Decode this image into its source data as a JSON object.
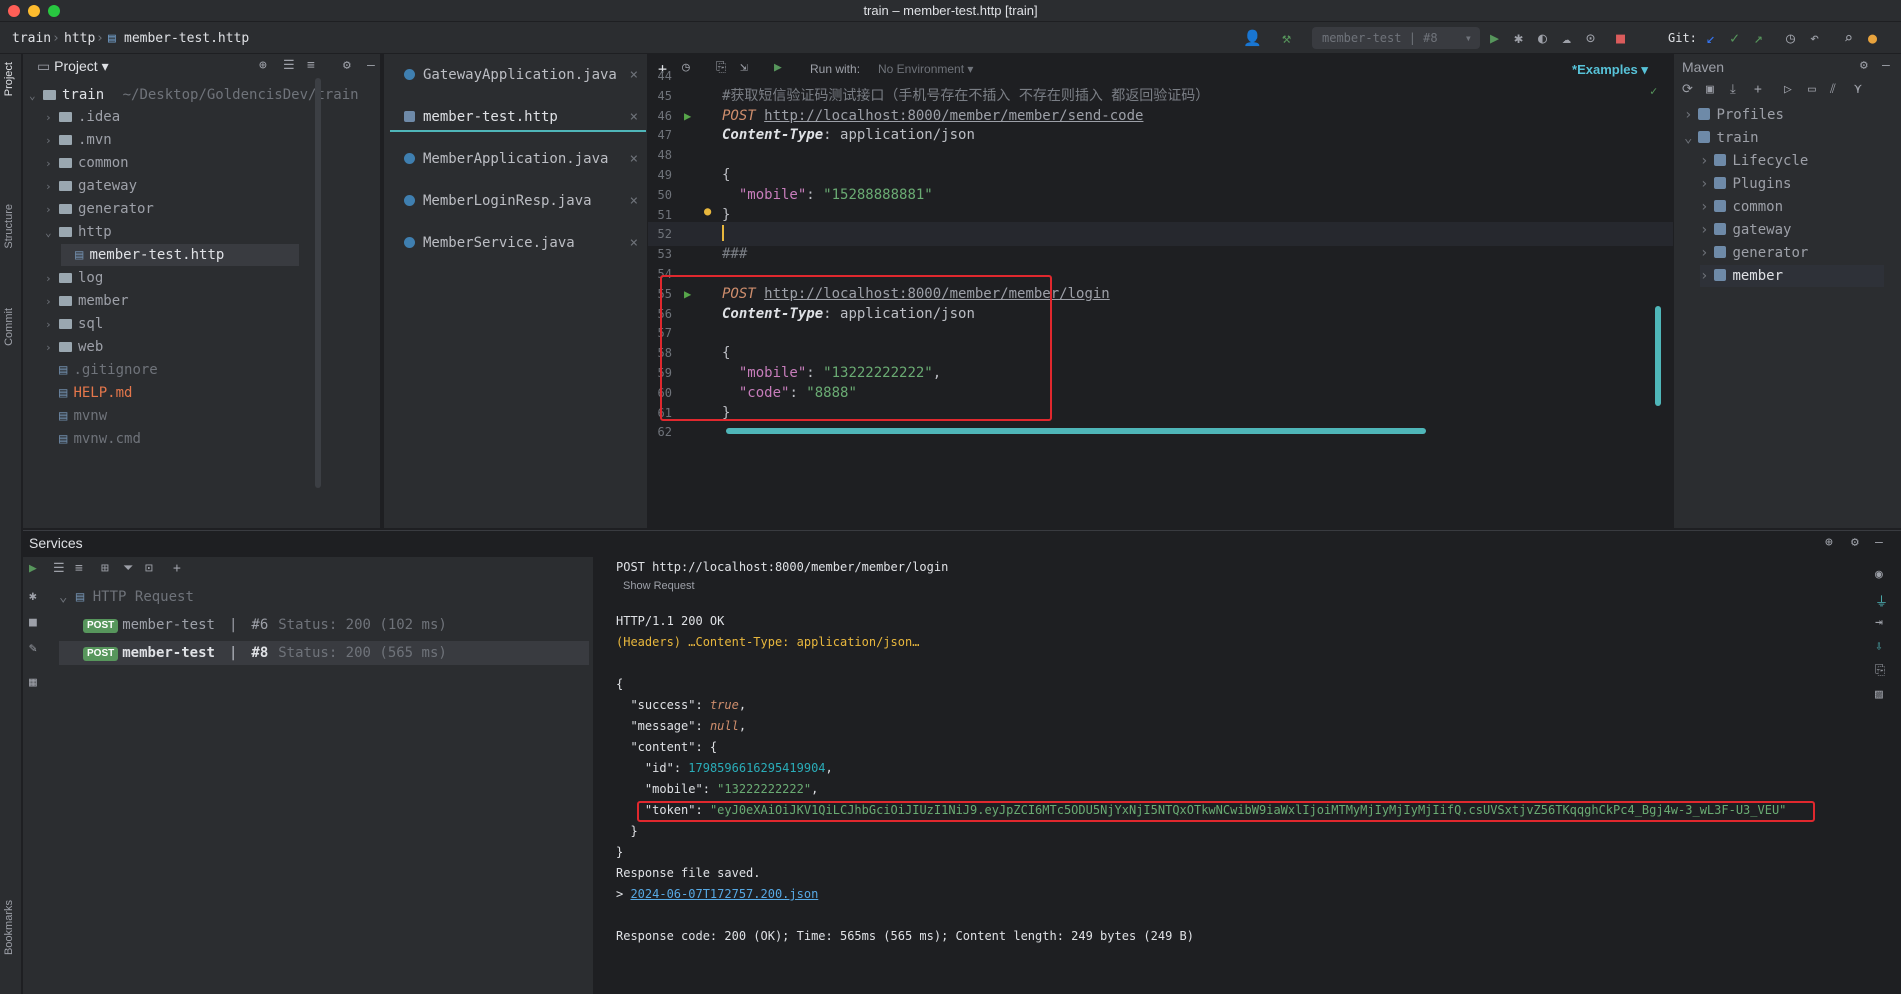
{
  "window": {
    "title": "train – member-test.http [train]"
  },
  "breadcrumb": [
    "train",
    "http",
    "member-test.http"
  ],
  "run_config": "member-test | #8",
  "git_label": "Git:",
  "left_strip": [
    "Project",
    "Structure",
    "Commit",
    "Bookmarks"
  ],
  "project": {
    "header": "Project",
    "root": {
      "name": "train",
      "path": "~/Desktop/GoldencisDev/train"
    },
    "items": [
      {
        "label": ".idea",
        "type": "folder",
        "indent": 1,
        "expanded": false
      },
      {
        "label": ".mvn",
        "type": "folder",
        "indent": 1,
        "expanded": false
      },
      {
        "label": "common",
        "type": "folder",
        "indent": 1,
        "expanded": false
      },
      {
        "label": "gateway",
        "type": "folder",
        "indent": 1,
        "expanded": false
      },
      {
        "label": "generator",
        "type": "folder",
        "indent": 1,
        "expanded": false
      },
      {
        "label": "http",
        "type": "folder",
        "indent": 1,
        "expanded": true
      },
      {
        "label": "member-test.http",
        "type": "file",
        "indent": 2,
        "selected": true
      },
      {
        "label": "log",
        "type": "folder",
        "indent": 1,
        "expanded": false
      },
      {
        "label": "member",
        "type": "folder",
        "indent": 1,
        "expanded": false
      },
      {
        "label": "sql",
        "type": "folder",
        "indent": 1,
        "expanded": false
      },
      {
        "label": "web",
        "type": "folder",
        "indent": 1,
        "expanded": false
      },
      {
        "label": ".gitignore",
        "type": "file",
        "indent": 1
      },
      {
        "label": "HELP.md",
        "type": "file",
        "indent": 1
      },
      {
        "label": "mvnw",
        "type": "file",
        "indent": 1
      },
      {
        "label": "mvnw.cmd",
        "type": "file",
        "indent": 1
      }
    ]
  },
  "tabs": [
    {
      "label": "GatewayApplication.java",
      "active": false
    },
    {
      "label": "member-test.http",
      "active": true
    },
    {
      "label": "MemberApplication.java",
      "active": false
    },
    {
      "label": "MemberLoginResp.java",
      "active": false
    },
    {
      "label": "MemberService.java",
      "active": false
    }
  ],
  "editor_toolbar": {
    "run_with_label": "Run with:",
    "env_value": "No Environment",
    "examples_label": "Examples"
  },
  "editor_lines": [
    {
      "n": "44",
      "tokens": []
    },
    {
      "n": "45",
      "tokens": [
        {
          "c": "k-cmt",
          "t": "#获取短信验证码测试接口（手机号存在不插入 不存在则插入 都返回验证码）"
        }
      ]
    },
    {
      "n": "46",
      "run": true,
      "tokens": [
        {
          "c": "k-method",
          "t": "POST "
        },
        {
          "c": "k-url",
          "t": "http://localhost:8000/member/member/send-code"
        }
      ]
    },
    {
      "n": "47",
      "tokens": [
        {
          "c": "k-hdr",
          "t": "Content-Type"
        },
        {
          "c": "",
          "t": ": application/json"
        }
      ]
    },
    {
      "n": "48",
      "tokens": []
    },
    {
      "n": "49",
      "tokens": [
        {
          "c": "",
          "t": "{"
        }
      ]
    },
    {
      "n": "50",
      "tokens": [
        {
          "c": "",
          "t": "  "
        },
        {
          "c": "k-key",
          "t": "\"mobile\""
        },
        {
          "c": "",
          "t": ": "
        },
        {
          "c": "k-str",
          "t": "\"15288888881\""
        }
      ]
    },
    {
      "n": "51",
      "tokens": [
        {
          "c": "",
          "t": "}"
        }
      ]
    },
    {
      "n": "52",
      "current": true,
      "tokens": []
    },
    {
      "n": "53",
      "tokens": [
        {
          "c": "k-cmt",
          "t": "###"
        }
      ]
    },
    {
      "n": "54",
      "tokens": []
    },
    {
      "n": "55",
      "run": true,
      "tokens": [
        {
          "c": "k-method",
          "t": "POST "
        },
        {
          "c": "k-url",
          "t": "http://localhost:8000/member/member/login"
        }
      ]
    },
    {
      "n": "56",
      "tokens": [
        {
          "c": "k-hdr",
          "t": "Content-Type"
        },
        {
          "c": "",
          "t": ": application/json"
        }
      ]
    },
    {
      "n": "57",
      "tokens": []
    },
    {
      "n": "58",
      "tokens": [
        {
          "c": "",
          "t": "{"
        }
      ]
    },
    {
      "n": "59",
      "tokens": [
        {
          "c": "",
          "t": "  "
        },
        {
          "c": "k-key",
          "t": "\"mobile\""
        },
        {
          "c": "",
          "t": ": "
        },
        {
          "c": "k-str",
          "t": "\"13222222222\""
        },
        {
          "c": "",
          "t": ","
        }
      ]
    },
    {
      "n": "60",
      "tokens": [
        {
          "c": "",
          "t": "  "
        },
        {
          "c": "k-key",
          "t": "\"code\""
        },
        {
          "c": "",
          "t": ": "
        },
        {
          "c": "k-str",
          "t": "\"8888\""
        }
      ]
    },
    {
      "n": "61",
      "tokens": [
        {
          "c": "",
          "t": "}"
        }
      ]
    },
    {
      "n": "62",
      "tokens": []
    }
  ],
  "maven": {
    "header": "Maven",
    "items": [
      {
        "label": "Profiles",
        "indent": 0
      },
      {
        "label": "train",
        "indent": 0,
        "expanded": true
      },
      {
        "label": "Lifecycle",
        "indent": 1
      },
      {
        "label": "Plugins",
        "indent": 1
      },
      {
        "label": "common",
        "indent": 1
      },
      {
        "label": "gateway",
        "indent": 1
      },
      {
        "label": "generator",
        "indent": 1
      },
      {
        "label": "member",
        "indent": 1,
        "selected": true
      }
    ]
  },
  "services": {
    "header": "Services",
    "group": "HTTP Request",
    "badge": "POST",
    "requests": [
      {
        "name": "member-test",
        "run": "#6",
        "status": "Status: 200 (102 ms)",
        "selected": false
      },
      {
        "name": "member-test",
        "run": "#8",
        "status": "Status: 200 (565 ms)",
        "selected": true
      }
    ]
  },
  "response": {
    "request_line": "POST http://localhost:8000/member/member/login",
    "show_request": "Show Request",
    "status_line": "HTTP/1.1 200 OK",
    "headers": "(Headers) …Content-Type: application/json…",
    "id": "1798596616295419904",
    "mobile": "\"13222222222\"",
    "token": "\"eyJ0eXAiOiJKV1QiLCJhbGciOiJIUzI1NiJ9.eyJpZCI6MTc5ODU5NjYxNjI5NTQxOTkwNCwibW9iaWxlIjoiMTMyMjIyMjIyMjIifQ.csUVSxtjvZ56TKqqghCkPc4_Bgj4w-3_wL3F-U3_VEU\"",
    "saved": "Response file saved.",
    "file_link": "2024-06-07T172757.200.json",
    "summary": "Response code: 200 (OK); Time: 565ms (565 ms); Content length: 249 bytes (249 B)"
  },
  "colors": {
    "accent": "#3574f0",
    "highlight_box": "#e0282e",
    "green": "#57965c"
  }
}
